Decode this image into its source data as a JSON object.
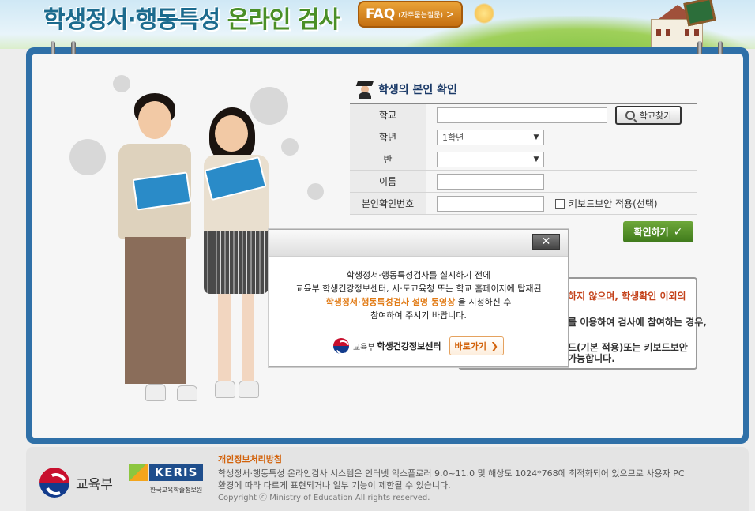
{
  "header": {
    "title_part1": "학생정서·행동특성",
    "title_part2": "온라인 검사",
    "faq_label": "FAQ",
    "faq_sub": "(자주묻는질문)",
    "faq_chevron": ">"
  },
  "form": {
    "title": "학생의 본인 확인",
    "school_label": "학교",
    "school_value": "",
    "find_school_label": "학교찾기",
    "grade_label": "학년",
    "grade_selected": "1학년",
    "class_label": "반",
    "class_selected": "",
    "name_label": "이름",
    "name_value": "",
    "id_label": "본인확인번호",
    "id_value": "",
    "keyboard_security_label": "키보드보안 적용(선택)",
    "confirm_label": "확인하기",
    "confirm_icon": "✓"
  },
  "notice": {
    "line1": "하지 않으며, 학생확인 이외의",
    "line2": "를 이용하여 검사에 참여하는 경우,",
    "line3": "드(기본 적용)또는 키보드보안",
    "line4": "가능합니다."
  },
  "modal": {
    "close_symbol": "✕",
    "line1": "학생정서·행동특성검사를 실시하기 전에",
    "line2": "교육부 학생건강정보센터, 시·도교육청 또는 학교 홈페이지에 탑재된",
    "line3_highlight": "학생정서·행동특성검사 설명 동영상",
    "line3_rest": " 을 시청하신 후",
    "line4": "참여하여 주시기 바랍니다.",
    "org_small": "교육부",
    "org_bold": "학생건강정보센터",
    "go_label": "바로가기",
    "go_arrow": "❯"
  },
  "footer": {
    "moe_name": "교육부",
    "keris_name": "KERIS",
    "keris_sub": "한국교육학술정보원",
    "privacy_label": "개인정보처리방침",
    "info_line1": "학생정서·행동특성 온라인검사 시스템은 인터넷 익스플로러 9.0~11.0 및 해상도 1024*768에 최적화되어 있으므로 사용자 PC",
    "info_line2": "환경에 따라 다르게 표현되거나 일부 기능이 제한될 수 있습니다.",
    "copyright": "Copyright ⓒ Ministry of Education All rights reserved."
  },
  "colors": {
    "frame_blue": "#2f70a8",
    "confirm_green": "#4f8b26",
    "accent_orange": "#e17a14",
    "title_blue": "#1c6b8e"
  }
}
